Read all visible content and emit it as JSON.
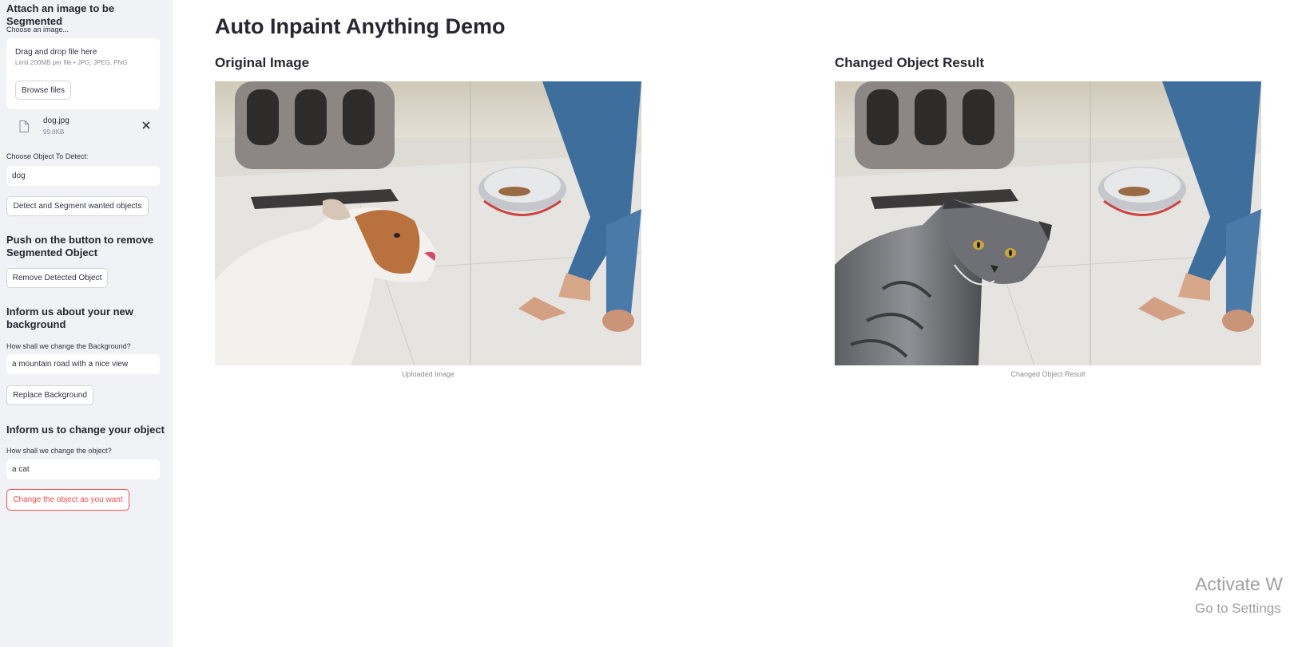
{
  "sidebar": {
    "upload_heading": "Attach an image to be Segmented",
    "upload_label": "Choose an image...",
    "dropzone_title": "Drag and drop file here",
    "dropzone_limit": "Limit 200MB per file • JPG, JPEG, PNG",
    "browse_label": "Browse files",
    "file_name": "dog.jpg",
    "file_size": "99.8KB",
    "detect_label": "Choose Object To Detect:",
    "detect_value": "dog",
    "detect_button": "Detect and Segment wanted objects",
    "remove_heading": "Push on the button to remove Segmented Object",
    "remove_button": "Remove Detected Object",
    "bg_heading": "Inform us about your new background",
    "bg_label": "How shall we change the Background?",
    "bg_value": "a mountain road with a nice view",
    "bg_button": "Replace Background",
    "obj_heading": "Inform us to change your object",
    "obj_label": "How shall we change the object?",
    "obj_value": "a cat",
    "obj_button": "Change the object as you want"
  },
  "main": {
    "title": "Auto Inpaint Anything Demo",
    "left_title": "Original Image",
    "left_caption": "Uploaded Image",
    "right_title": "Changed Object Result",
    "right_caption": "Changed Object Result"
  },
  "watermark": {
    "line1": "Activate W",
    "line2": "Go to Settings"
  },
  "icons": {
    "file": "file-icon",
    "close": "close-icon"
  },
  "colors": {
    "sidebar_bg": "#f0f2f6",
    "primary_red": "#ff4b4b",
    "text": "#31333f"
  }
}
